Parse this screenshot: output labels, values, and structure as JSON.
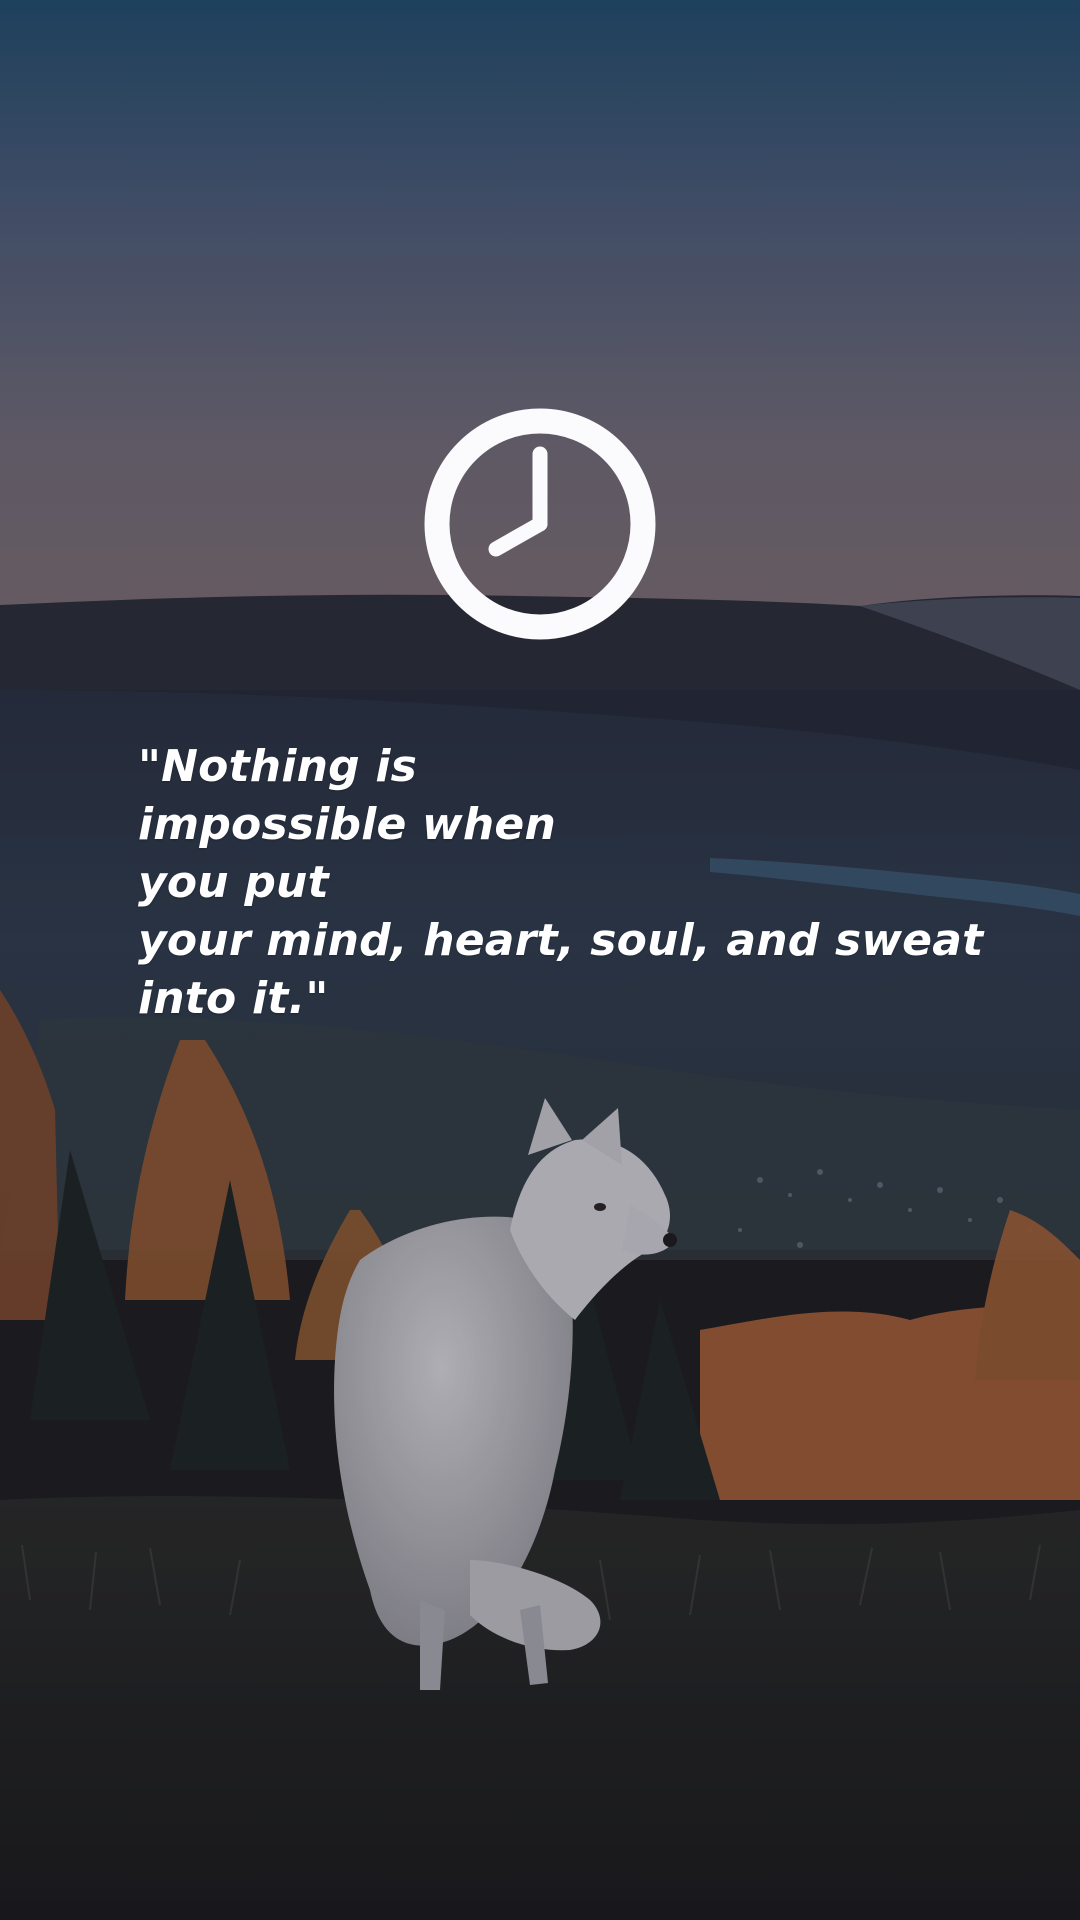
{
  "lock_screen": {
    "clock_icon": "clock-icon",
    "quote_text": "\"Nothing is\nimpossible when\nyou put\nyour mind, heart, soul, and sweat\ninto it.\""
  },
  "colors": {
    "sky_top": "#234a6a",
    "sky_bottom": "#6f6673",
    "foreground_text": "#ffffff",
    "autumn_accent": "#b86a3f"
  }
}
